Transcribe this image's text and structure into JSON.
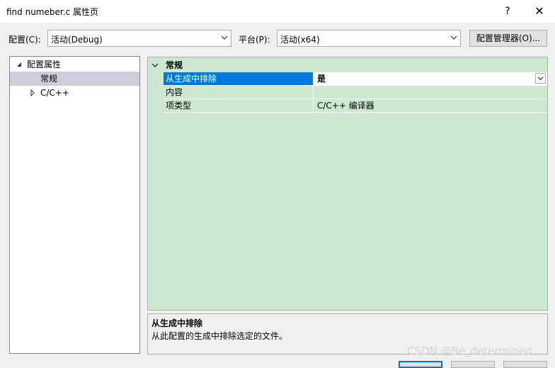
{
  "window": {
    "title": "find numeber.c 属性页",
    "help_glyph": "?",
    "close_glyph": "✕"
  },
  "toolbar": {
    "config_label": "配置(C):",
    "config_value": "活动(Debug)",
    "platform_label": "平台(P):",
    "platform_value": "活动(x64)",
    "config_manager_label": "配置管理器(O)..."
  },
  "tree": {
    "root_label": "配置属性",
    "items": [
      {
        "label": "常规"
      },
      {
        "label": "C/C++"
      }
    ]
  },
  "grid": {
    "category": "常规",
    "rows": [
      {
        "name": "从生成中排除",
        "value": "是"
      },
      {
        "name": "内容",
        "value": ""
      },
      {
        "name": "项类型",
        "value": "C/C++ 编译器"
      }
    ]
  },
  "description": {
    "title": "从生成中排除",
    "text": "从此配置的生成中排除选定的文件。"
  },
  "watermark": "CSDN @Be_determined",
  "colors": {
    "selection": "#0078d7",
    "grid_bg": "#cce8cf",
    "tree_selection": "#cccedb"
  },
  "icons": [
    "chevron-down-icon",
    "tree-expanded-icon",
    "tree-collapsed-icon"
  ]
}
